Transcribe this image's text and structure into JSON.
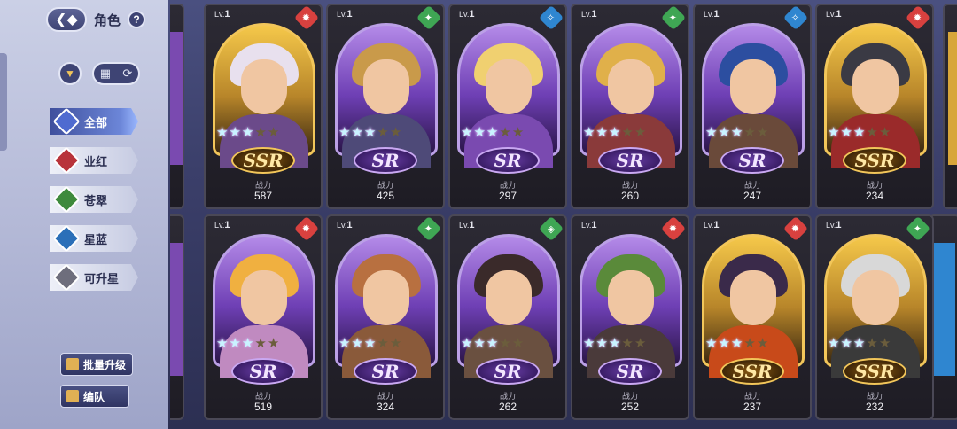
{
  "header": {
    "title": "角色",
    "help": "?"
  },
  "sidebar": {
    "categories": [
      {
        "label": "全部",
        "color": "#4f6bd0",
        "active": true
      },
      {
        "label": "业红",
        "color": "#b8333a",
        "active": false
      },
      {
        "label": "苍翠",
        "color": "#3e8a3c",
        "active": false
      },
      {
        "label": "星蓝",
        "color": "#2b6fb8",
        "active": false
      },
      {
        "label": "可升星",
        "color": "#6e6e7c",
        "active": false
      }
    ],
    "batch_upgrade": "批量升级",
    "formation": "编队"
  },
  "card_common": {
    "lv_prefix": "Lv.",
    "power_label": "战力"
  },
  "cards": [
    {
      "level": "1",
      "power": "587",
      "rank": "SSR",
      "stars": 3,
      "element": "fire",
      "element_color": "#d8413f",
      "hair": "#e8e0ee",
      "body": "#6b4a8a"
    },
    {
      "level": "1",
      "power": "425",
      "rank": "SR",
      "stars": 3,
      "element": "wind",
      "element_color": "#3fa654",
      "hair": "#c99a4a",
      "body": "#4e4a78"
    },
    {
      "level": "1",
      "power": "297",
      "rank": "SR",
      "stars": 3,
      "element": "water",
      "element_color": "#2f86d0",
      "hair": "#f0d070",
      "body": "#7a4ab0"
    },
    {
      "level": "1",
      "power": "260",
      "rank": "SR",
      "stars": 3,
      "element": "wind",
      "element_color": "#3fa654",
      "hair": "#e0b04a",
      "body": "#8a3a3a"
    },
    {
      "level": "1",
      "power": "247",
      "rank": "SR",
      "stars": 3,
      "element": "water",
      "element_color": "#2f86d0",
      "hair": "#2c4ea0",
      "body": "#6a4a3a"
    },
    {
      "level": "1",
      "power": "234",
      "rank": "SSR",
      "stars": 3,
      "element": "fire",
      "element_color": "#d8413f",
      "hair": "#3a3a44",
      "body": "#9a2a2a"
    },
    {
      "level": "1",
      "power": "519",
      "rank": "SR",
      "stars": 3,
      "element": "fire",
      "element_color": "#d8413f",
      "hair": "#f0b040",
      "body": "#c08ac0"
    },
    {
      "level": "1",
      "power": "324",
      "rank": "SR",
      "stars": 3,
      "element": "wind",
      "element_color": "#3fa654",
      "hair": "#b87040",
      "body": "#8a5a3a"
    },
    {
      "level": "1",
      "power": "262",
      "rank": "SR",
      "stars": 3,
      "element": "shield",
      "element_color": "#3fa654",
      "hair": "#3a2a2a",
      "body": "#6a5040"
    },
    {
      "level": "1",
      "power": "252",
      "rank": "SR",
      "stars": 3,
      "element": "fire",
      "element_color": "#d8413f",
      "hair": "#5a8a3a",
      "body": "#4a3a3a"
    },
    {
      "level": "1",
      "power": "237",
      "rank": "SSR",
      "stars": 3,
      "element": "fire",
      "element_color": "#d8413f",
      "hair": "#3a2a4a",
      "body": "#c84a1a"
    },
    {
      "level": "1",
      "power": "232",
      "rank": "SSR",
      "stars": 3,
      "element": "wind",
      "element_color": "#3fa654",
      "hair": "#d8d8d8",
      "body": "#3a3a3a"
    }
  ]
}
